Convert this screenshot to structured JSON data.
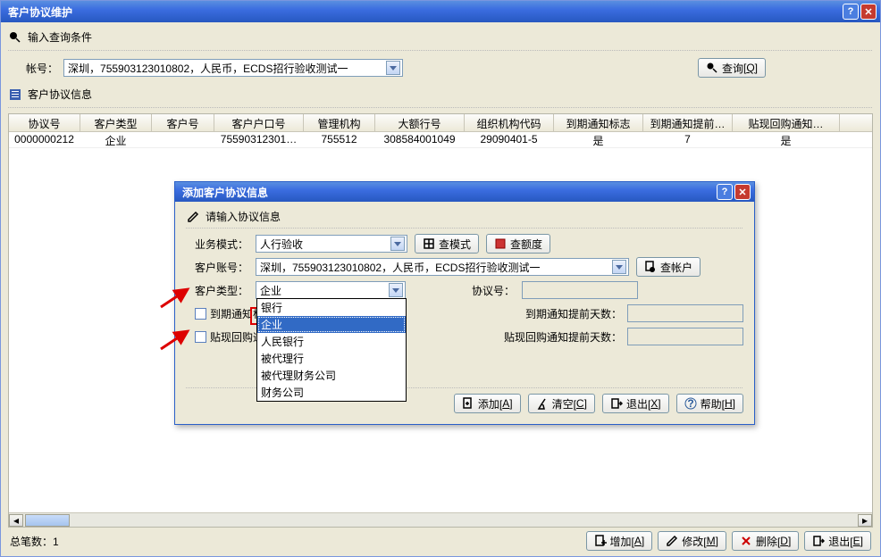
{
  "main_window": {
    "title": "客户协议维护",
    "section_query": "输入查询条件",
    "account_label": "帐号：",
    "account_value": "深圳，755903123010802，人民币，ECDS招行验收测试一",
    "query_btn": "查询",
    "query_hotkey": "Q",
    "section_info": "客户协议信息"
  },
  "table": {
    "headers": [
      "协议号",
      "客户类型",
      "客户号",
      "客户户口号",
      "管理机构",
      "大额行号",
      "组织机构代码",
      "到期通知标志",
      "到期通知提前…",
      "贴现回购通知…"
    ],
    "rows": [
      [
        "0000000212",
        "企业",
        "",
        "75590312301…",
        "755512",
        "308584001049",
        "29090401-5",
        "是",
        "7",
        "是"
      ]
    ]
  },
  "footer": {
    "count_label": "总笔数：1",
    "buttons": [
      {
        "label": "增加",
        "hotkey": "A",
        "icon": "plus"
      },
      {
        "label": "修改",
        "hotkey": "M",
        "icon": "pencil"
      },
      {
        "label": "删除",
        "hotkey": "D",
        "icon": "x-red"
      },
      {
        "label": "退出",
        "hotkey": "E",
        "icon": "exit"
      }
    ]
  },
  "dialog": {
    "title": "添加客户协议信息",
    "section": "请输入协议信息",
    "rows": {
      "biz_mode_label": "业务模式：",
      "biz_mode_value": "人行验收",
      "btn_view_mode": "查模式",
      "btn_view_quota": "查额度",
      "cust_account_label": "客户账号：",
      "cust_account_value": "深圳，755903123010802，人民币，ECDS招行验收测试一",
      "btn_view_account": "查帐户",
      "cust_type_label": "客户类型：",
      "cust_type_value": "企业",
      "proto_no_label": "协议号：",
      "proto_no_value": "",
      "due_flag_label": "到期通知标志",
      "due_days_label": "到期通知提前天数：",
      "due_days_value": "",
      "repo_flag_label": "贴现回购通知标志",
      "repo_days_label": "贴现回购通知提前天数：",
      "repo_days_value": ""
    },
    "type_options": [
      "银行",
      "企业",
      "人民银行",
      "被代理行",
      "被代理财务公司",
      "财务公司"
    ],
    "type_selected_index": 1,
    "buttons": [
      {
        "label": "添加",
        "hotkey": "A",
        "icon": "plus-doc"
      },
      {
        "label": "清空",
        "hotkey": "C",
        "icon": "broom"
      },
      {
        "label": "退出",
        "hotkey": "X",
        "icon": "exit"
      },
      {
        "label": "帮助",
        "hotkey": "H",
        "icon": "help"
      }
    ]
  }
}
